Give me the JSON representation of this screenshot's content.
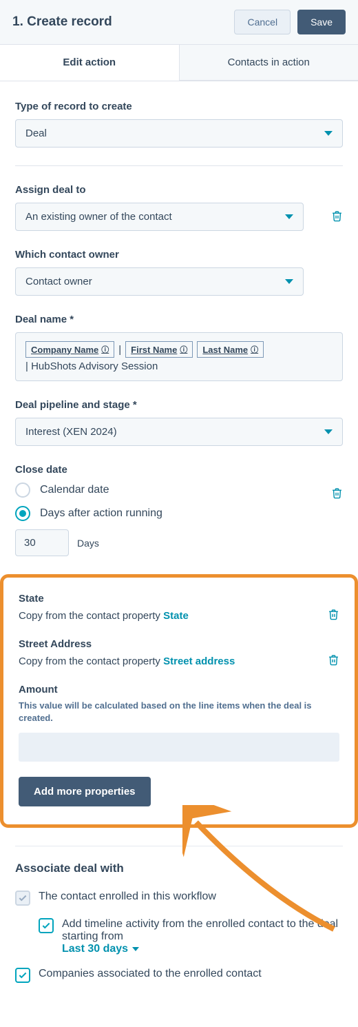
{
  "header": {
    "title": "1. Create record",
    "cancel": "Cancel",
    "save": "Save"
  },
  "tabs": {
    "edit": "Edit action",
    "contacts": "Contacts in action"
  },
  "type_section": {
    "label": "Type of record to create",
    "value": "Deal"
  },
  "assign_section": {
    "label": "Assign deal to",
    "value": "An existing owner of the contact"
  },
  "owner_section": {
    "label": "Which contact owner",
    "value": "Contact owner"
  },
  "dealname_section": {
    "label": "Deal name *",
    "tokens": {
      "company": "Company Name",
      "first": "First Name",
      "last": "Last Name"
    },
    "separator": "|",
    "line2": "| HubShots Advisory Session"
  },
  "pipeline_section": {
    "label": "Deal pipeline and stage *",
    "value": "Interest (XEN 2024)"
  },
  "close_section": {
    "label": "Close date",
    "option1": "Calendar date",
    "option2": "Days after action running",
    "days_value": "30",
    "days_unit": "Days"
  },
  "state_section": {
    "label": "State",
    "prefix": "Copy from the contact property ",
    "link": "State"
  },
  "street_section": {
    "label": "Street Address",
    "prefix": "Copy from the contact property ",
    "link": "Street address"
  },
  "amount_section": {
    "label": "Amount",
    "helper": "This value will be calculated based on the line items when the deal is created."
  },
  "add_more_btn": "Add more properties",
  "associate": {
    "title": "Associate deal with",
    "cb1": "The contact enrolled in this workflow",
    "cb1_sub_prefix": "Add timeline activity from the enrolled contact to the deal starting from",
    "cb1_sub_link": "Last 30 days",
    "cb2": "Companies associated to the enrolled contact"
  }
}
